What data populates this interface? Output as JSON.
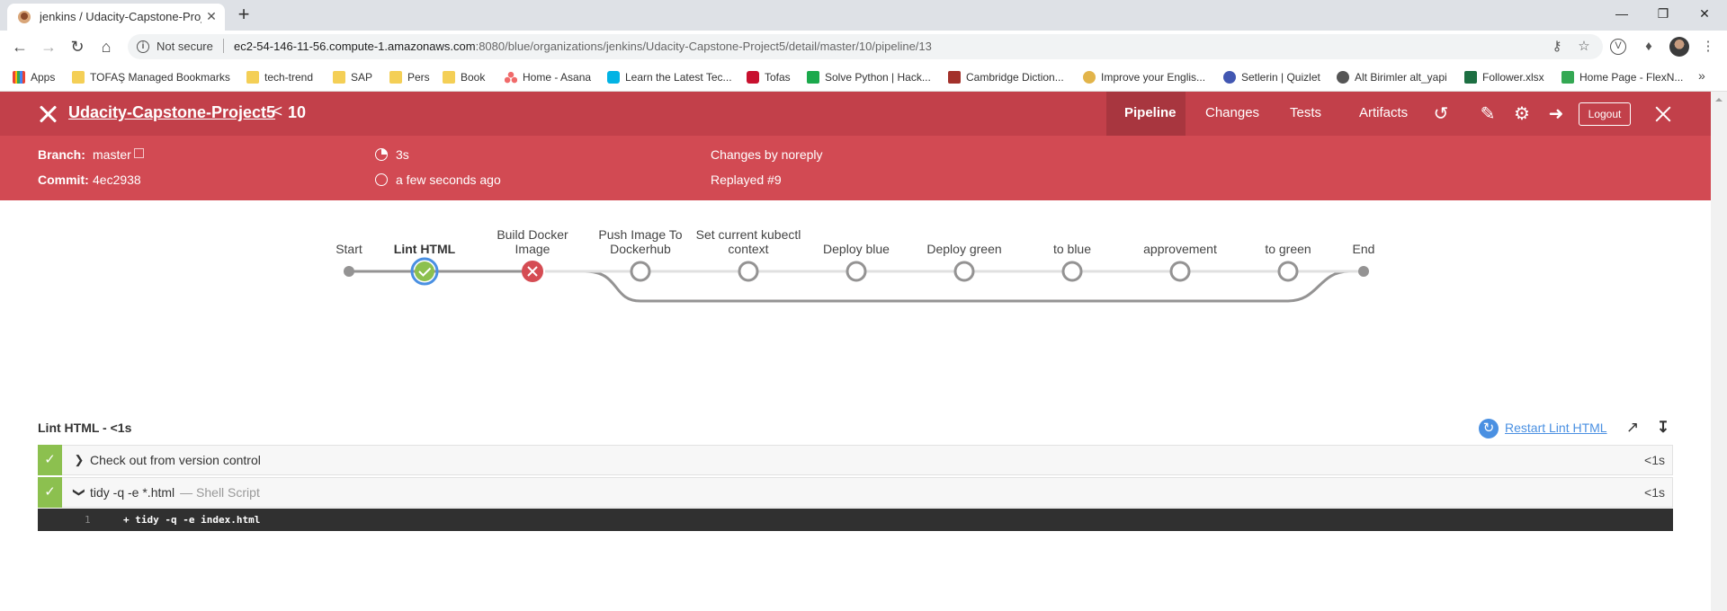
{
  "browser": {
    "tab_title": "jenkins / Udacity-Capstone-Proje",
    "tab_close": "✕",
    "new_tab": "+",
    "window_controls": [
      "—",
      "❐",
      "✕"
    ],
    "security_label": "Not secure",
    "url_host": "ec2-54-146-11-56.compute-1.amazonaws.com",
    "url_rest": ":8080/blue/organizations/jenkins/Udacity-Capstone-Project5/detail/master/10/pipeline/13",
    "bookmarks": [
      {
        "label": "Apps",
        "icon": "apps-grid-icon"
      },
      {
        "label": "TOFAŞ Managed Bookmarks",
        "icon": "folder-icon"
      },
      {
        "label": "tech-trend",
        "icon": "folder-icon"
      },
      {
        "label": "SAP",
        "icon": "folder-icon"
      },
      {
        "label": "Pers",
        "icon": "folder-icon"
      },
      {
        "label": "Book",
        "icon": "folder-icon"
      },
      {
        "label": "Home - Asana",
        "icon": "asana-icon"
      },
      {
        "label": "Learn the Latest Tec...",
        "icon": "udacity-icon"
      },
      {
        "label": "Tofas",
        "icon": "tofas-icon"
      },
      {
        "label": "Solve Python | Hack...",
        "icon": "hackerrank-icon"
      },
      {
        "label": "Cambridge Diction...",
        "icon": "cambridge-icon"
      },
      {
        "label": "Improve your Englis...",
        "icon": "improve-icon"
      },
      {
        "label": "Setlerin | Quizlet",
        "icon": "quizlet-icon"
      },
      {
        "label": "Alt Birimler alt_yapi",
        "icon": "globe-icon"
      },
      {
        "label": "Follower.xlsx",
        "icon": "excel-icon"
      },
      {
        "label": "Home Page - FlexN...",
        "icon": "sheets-icon"
      }
    ],
    "bookmarks_more": "»"
  },
  "header": {
    "project": "Udacity-Capstone-Project5",
    "crumb_sep": "<",
    "run_number": "10",
    "tabs": [
      "Pipeline",
      "Changes",
      "Tests",
      "Artifacts"
    ],
    "active_tab": "Pipeline",
    "logout": "Logout"
  },
  "run_info": {
    "branch_label": "Branch:",
    "branch": "master",
    "commit_label": "Commit:",
    "commit": "4ec2938",
    "duration": "3s",
    "time_ago": "a few seconds ago",
    "changes": "Changes by noreply",
    "replayed": "Replayed #9"
  },
  "pipeline": {
    "stages": [
      {
        "name": "Start",
        "status": "marker"
      },
      {
        "name": "Lint HTML",
        "status": "success",
        "selected": true
      },
      {
        "name": "Build Docker Image",
        "status": "failed"
      },
      {
        "name": "Push Image To Dockerhub",
        "status": "not-built"
      },
      {
        "name": "Set current kubectl context",
        "status": "not-built"
      },
      {
        "name": "Deploy blue",
        "status": "not-built"
      },
      {
        "name": "Deploy green",
        "status": "not-built"
      },
      {
        "name": "to blue",
        "status": "not-built"
      },
      {
        "name": "approvement",
        "status": "not-built"
      },
      {
        "name": "to green",
        "status": "not-built"
      },
      {
        "name": "End",
        "status": "marker"
      }
    ],
    "colors": {
      "success": "#8cc04f",
      "failed": "#d54c53",
      "selected_ring": "#4a90e2",
      "line_done": "#949393",
      "line_pending": "#e0e0e0",
      "pending_ring": "#949393"
    }
  },
  "steps": {
    "header": "Lint HTML - <1s",
    "restart": "Restart Lint HTML",
    "rows": [
      {
        "title": "Check out from version control",
        "sub": "",
        "duration": "<1s",
        "expanded": false
      },
      {
        "title": "tidy -q -e *.html",
        "sub": "— Shell Script",
        "duration": "<1s",
        "expanded": true
      }
    ],
    "log": [
      {
        "line": "1",
        "text": "+ tidy -q -e index.html"
      }
    ]
  }
}
